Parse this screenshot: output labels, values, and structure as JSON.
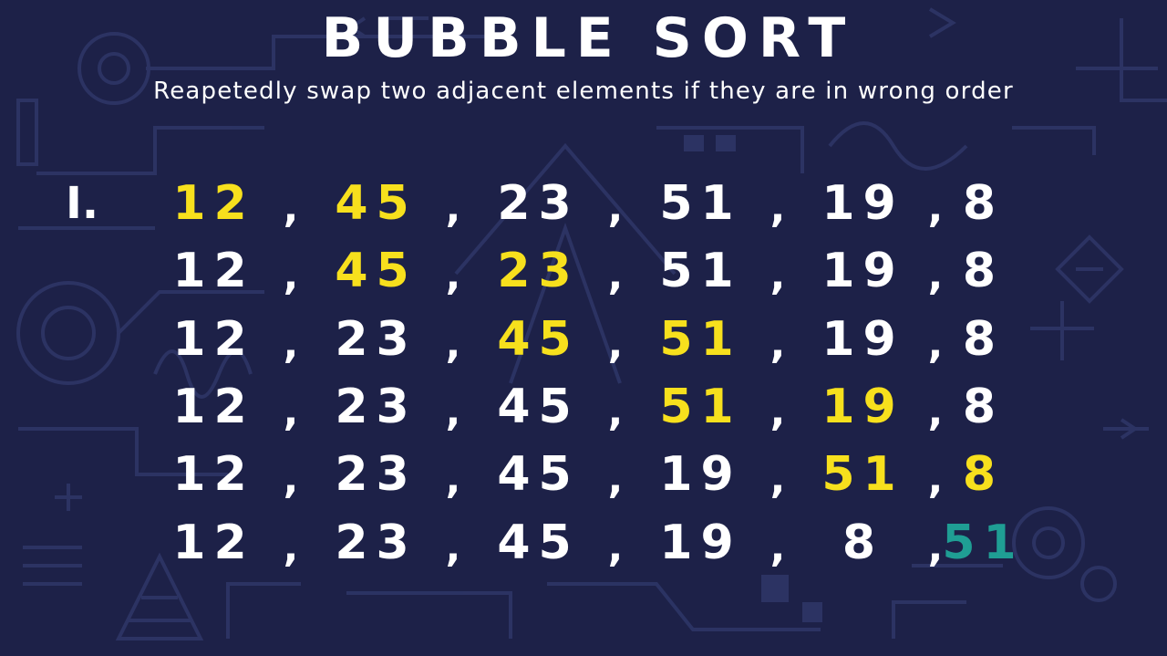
{
  "slide": {
    "title": "BUBBLE SORT",
    "subtitle": "Reapetedly swap two adjacent elements if they are in wrong order",
    "pass_label": "I.",
    "separator": ",",
    "colors": {
      "background": "#1d2148",
      "compare_highlight": "#f7e01d",
      "sorted_highlight": "#1f9e94",
      "default_text": "#ffffff"
    },
    "rows": [
      {
        "values": [
          "12",
          "45",
          "23",
          "51",
          "19",
          "8"
        ],
        "states": [
          "compare",
          "compare",
          "normal",
          "normal",
          "normal",
          "normal"
        ]
      },
      {
        "values": [
          "12",
          "45",
          "23",
          "51",
          "19",
          "8"
        ],
        "states": [
          "normal",
          "compare",
          "compare",
          "normal",
          "normal",
          "normal"
        ]
      },
      {
        "values": [
          "12",
          "23",
          "45",
          "51",
          "19",
          "8"
        ],
        "states": [
          "normal",
          "normal",
          "compare",
          "compare",
          "normal",
          "normal"
        ]
      },
      {
        "values": [
          "12",
          "23",
          "45",
          "51",
          "19",
          "8"
        ],
        "states": [
          "normal",
          "normal",
          "normal",
          "compare",
          "compare",
          "normal"
        ]
      },
      {
        "values": [
          "12",
          "23",
          "45",
          "19",
          "51",
          "8"
        ],
        "states": [
          "normal",
          "normal",
          "normal",
          "normal",
          "compare",
          "compare"
        ]
      },
      {
        "values": [
          "12",
          "23",
          "45",
          "19",
          "8",
          "51"
        ],
        "states": [
          "normal",
          "normal",
          "normal",
          "normal",
          "normal",
          "sorted"
        ]
      }
    ]
  }
}
